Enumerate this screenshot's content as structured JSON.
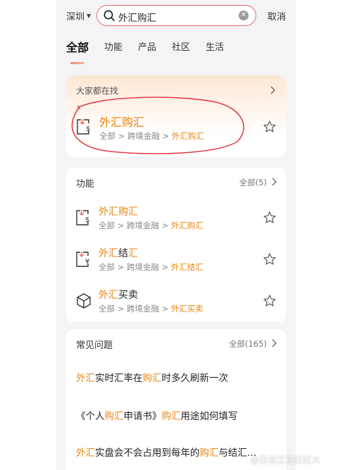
{
  "header": {
    "city": "深圳",
    "search_query": "外汇购汇",
    "cancel_label": "取消"
  },
  "tabs": [
    "全部",
    "功能",
    "产品",
    "社区",
    "生活"
  ],
  "popular": {
    "heading": "大家都在找",
    "title": "外汇购汇",
    "path_prefix": "全部 > 跨境金融 > ",
    "path_highlight": "外汇购汇"
  },
  "functions": {
    "heading": "功能",
    "more_label": "全部(5)",
    "items": [
      {
        "title_hl": "外汇购汇",
        "title_rest": "",
        "path_prefix": "全部 > 跨境金融 > ",
        "path_highlight": "外汇购汇"
      },
      {
        "title_hl": "外汇",
        "title_rest": "结",
        "title_hl2": "汇",
        "path_prefix": "全部 > 跨境金融 > ",
        "path_highlight": "外汇结汇"
      },
      {
        "title_hl": "外汇",
        "title_rest": "买卖",
        "path_prefix": "全部 > 跨境金融 > ",
        "path_highlight": "外汇买卖"
      }
    ]
  },
  "faq": {
    "heading": "常见问题",
    "more_label": "全部(165)",
    "items": [
      {
        "parts": [
          {
            "t": "外汇",
            "hl": true
          },
          {
            "t": "实时汇率在",
            "hl": false
          },
          {
            "t": "购汇",
            "hl": true
          },
          {
            "t": "时多久刷新一次",
            "hl": false
          }
        ]
      },
      {
        "parts": [
          {
            "t": "《个人",
            "hl": false
          },
          {
            "t": "购汇",
            "hl": true
          },
          {
            "t": "申请书》",
            "hl": false
          },
          {
            "t": "购汇",
            "hl": true
          },
          {
            "t": "用途如何填写",
            "hl": false
          }
        ]
      },
      {
        "parts": [
          {
            "t": "外汇",
            "hl": true
          },
          {
            "t": "实盘会不会占用到每年的",
            "hl": false
          },
          {
            "t": "购汇",
            "hl": true
          },
          {
            "t": "与结汇…",
            "hl": false
          }
        ]
      }
    ]
  },
  "watermark": "@日出江花红红火",
  "colors": {
    "accent": "#e8850f",
    "search_border": "#e56a66",
    "annotation": "#e0404a"
  }
}
